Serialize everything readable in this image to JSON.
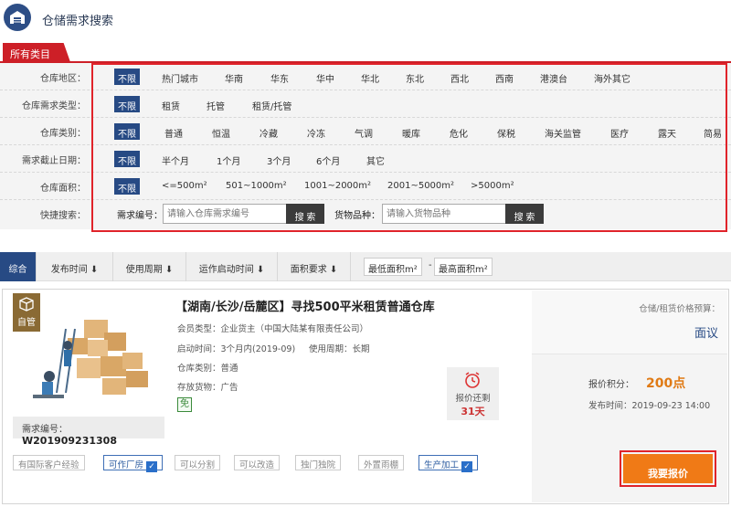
{
  "header": {
    "title": "仓储需求搜索"
  },
  "category_tab": "所有类目",
  "filters": {
    "region": {
      "label": "仓库地区：",
      "options": [
        "不限",
        "热门城市",
        "华南",
        "华东",
        "华中",
        "华北",
        "东北",
        "西北",
        "西南",
        "港澳台",
        "海外其它"
      ]
    },
    "req_type": {
      "label": "仓库需求类型：",
      "options": [
        "不限",
        "租赁",
        "托管",
        "租赁/托管"
      ]
    },
    "wh_type": {
      "label": "仓库类别：",
      "options": [
        "不限",
        "普通",
        "恒温",
        "冷藏",
        "冷冻",
        "气调",
        "暖库",
        "危化",
        "保税",
        "海关监管",
        "医疗",
        "露天",
        "简易"
      ]
    },
    "deadline": {
      "label": "需求截止日期：",
      "options": [
        "不限",
        "半个月",
        "1个月",
        "3个月",
        "6个月",
        "其它"
      ]
    },
    "area": {
      "label": "仓库面积：",
      "options": [
        "不限",
        "<=500m²",
        "501~1000m²",
        "1001~2000m²",
        "2001~5000m²",
        ">5000m²"
      ]
    },
    "quick": {
      "label": "快捷搜索：",
      "req_no_label": "需求编号：",
      "req_no_placeholder": "请输入仓库需求编号",
      "goods_label": "货物品种：",
      "goods_placeholder": "请输入货物品种",
      "search_btn": "搜 索"
    }
  },
  "sortbar": {
    "items": [
      "综合",
      "发布时间",
      "使用周期",
      "运作启动时间",
      "面积要求"
    ],
    "arrow": "⬇",
    "min_area": "最低面积m²",
    "dash": "-",
    "max_area": "最高面积m²"
  },
  "listing": {
    "badge": "自管",
    "title": "【湖南/长沙/岳麓区】寻找500平米租赁普通仓库",
    "member": "会员类型：企业货主（中国大陆某有限责任公司）",
    "start": "启动时间：3个月内(2019-09)",
    "cycle": "使用周期：长期",
    "wh_type": "仓库类别：普通",
    "goods": "存放货物：广告",
    "free_icon": "免",
    "remain_label": "报价还剩",
    "remain_days": "31天",
    "req_no_label": "需求编号：",
    "req_no": "W201909231308",
    "budget_label": "仓储/租赁价格预算：",
    "budget": "面议",
    "score_label": "报价积分：",
    "score": "200点",
    "publish": "发布时间：2019-09-23 14:00",
    "quote_btn": "我要报价",
    "tags": [
      {
        "text": "有国际客户经验",
        "on": false
      },
      {
        "text": "可作厂房",
        "on": true
      },
      {
        "text": "可以分割",
        "on": false
      },
      {
        "text": "可以改造",
        "on": false
      },
      {
        "text": "独门独院",
        "on": false
      },
      {
        "text": "外置雨棚",
        "on": false
      },
      {
        "text": "生产加工",
        "on": true
      }
    ],
    "check": "✓"
  },
  "colors": {
    "brand": "#274a84",
    "accent": "#cd1f27",
    "orange": "#f07a16"
  }
}
